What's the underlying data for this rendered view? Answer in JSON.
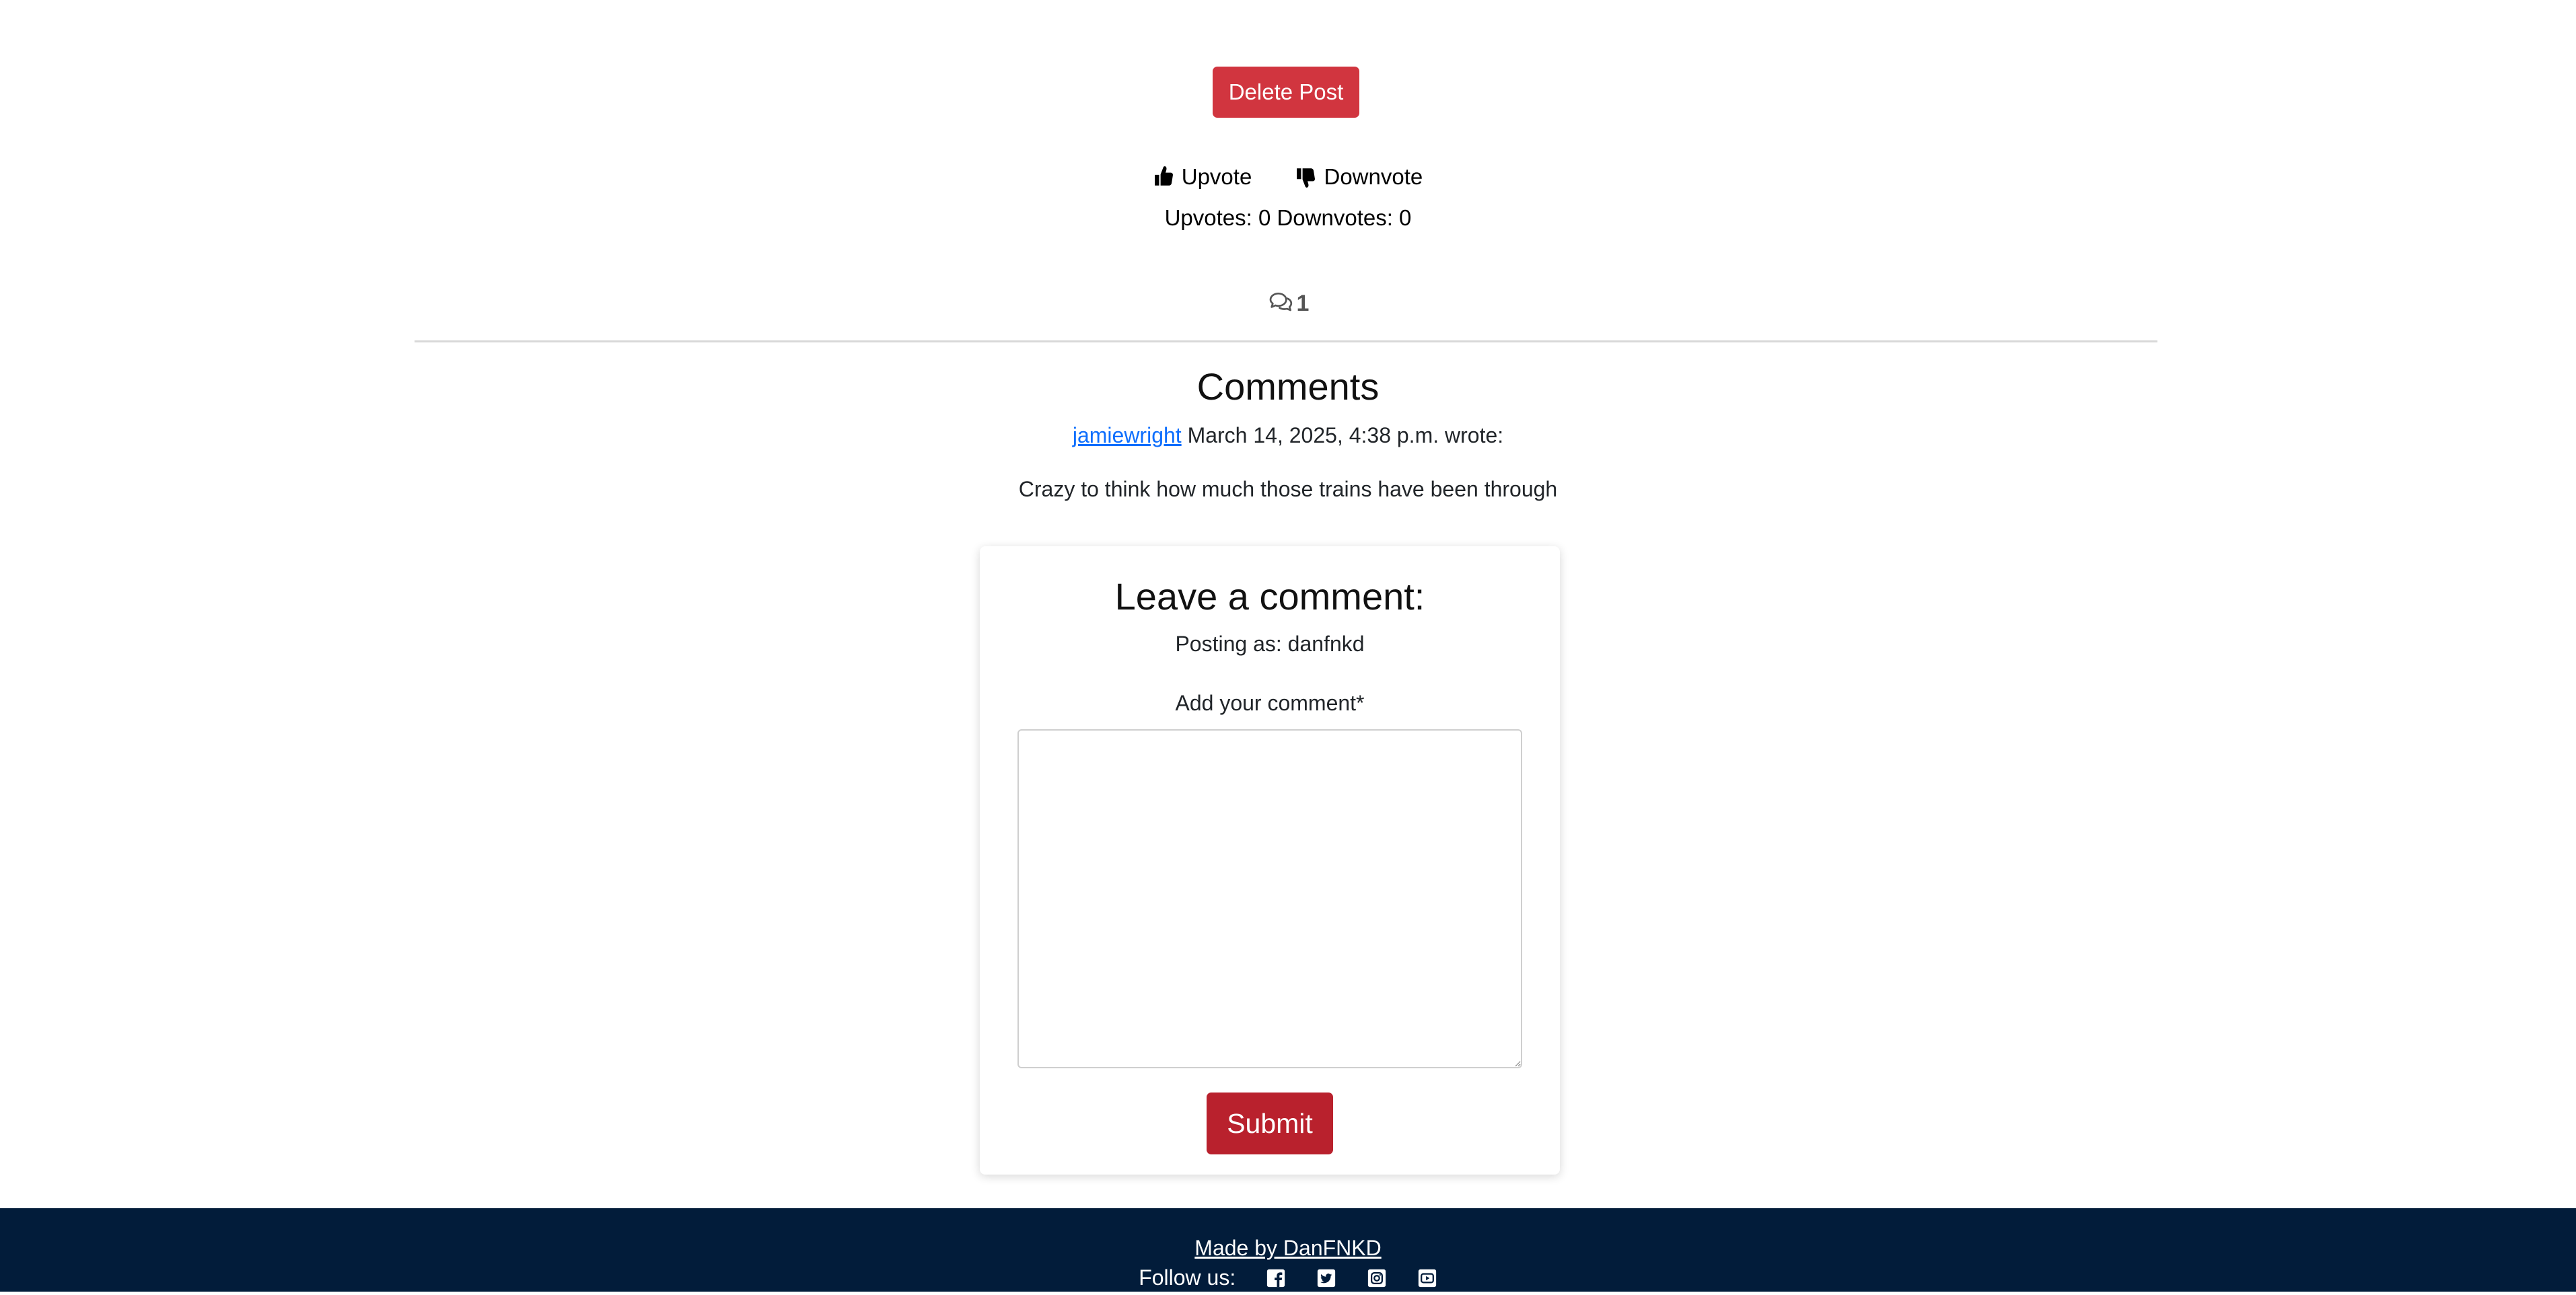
{
  "post": {
    "delete_label": "Delete Post",
    "upvote_label": "Upvote",
    "downvote_label": "Downvote",
    "counts_text": "Upvotes: 0 Downvotes: 0",
    "comment_count": "1"
  },
  "comments": {
    "heading": "Comments",
    "items": [
      {
        "author": "jamiewright",
        "meta": " March 14, 2025, 4:38 p.m. wrote:",
        "body": "Crazy to think how much those trains have been through"
      }
    ]
  },
  "form": {
    "title": "Leave a comment:",
    "posting_as": "Posting as: danfnkd",
    "label": "Add your comment*",
    "comment_value": "",
    "submit_label": "Submit"
  },
  "footer": {
    "made_by": "Made by DanFNKD",
    "follow_label": "Follow us:",
    "social_icons": [
      "facebook-icon",
      "twitter-icon",
      "instagram-icon",
      "youtube-icon"
    ]
  },
  "colors": {
    "danger": "#d1353f",
    "submit": "#b9212d",
    "link": "#0d6efd",
    "footer_bg": "#021c3a"
  }
}
